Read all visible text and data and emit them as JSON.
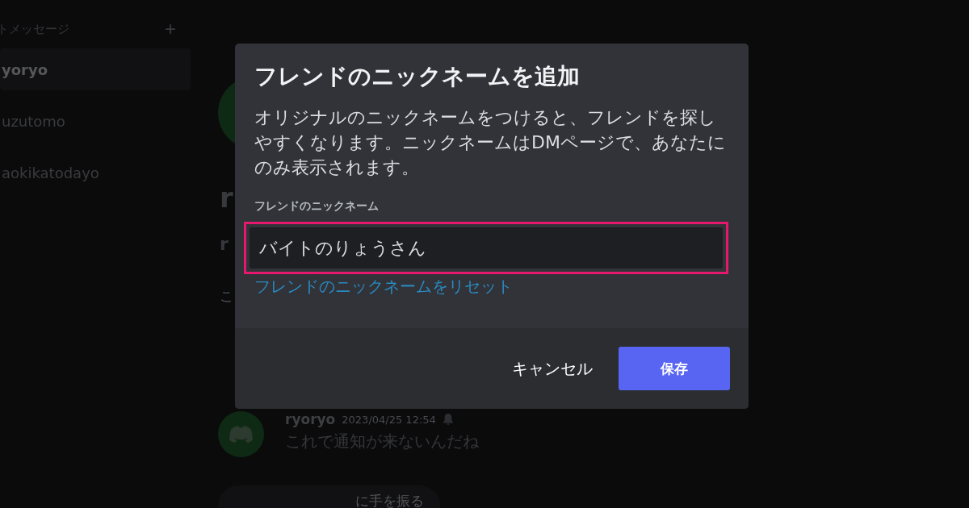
{
  "sidebar": {
    "header": "トメッセージ",
    "add_button": "+",
    "items": [
      {
        "name": "yoryo",
        "selected": true
      },
      {
        "name": "uzutomo",
        "selected": false
      },
      {
        "name": "aokikatodayo",
        "selected": false
      }
    ]
  },
  "background_chat": {
    "fragments": [
      "r",
      "r",
      "こ"
    ],
    "message": {
      "author": "ryoryo",
      "timestamp": "2023/04/25 12:54",
      "text": "これで通知が来ないんだね"
    },
    "wave_button": "に手を振る"
  },
  "dialog": {
    "title": "フレンドのニックネームを追加",
    "description": "オリジナルのニックネームをつけると、フレンドを探しやすくなります。ニックネームはDMページで、あなたにのみ表示されます。",
    "field_label": "フレンドのニックネーム",
    "field_value": "バイトのりょうさん",
    "highlighted": true,
    "reset_link": "フレンドのニックネームをリセット",
    "cancel_button": "キャンセル",
    "save_button": "保存"
  }
}
